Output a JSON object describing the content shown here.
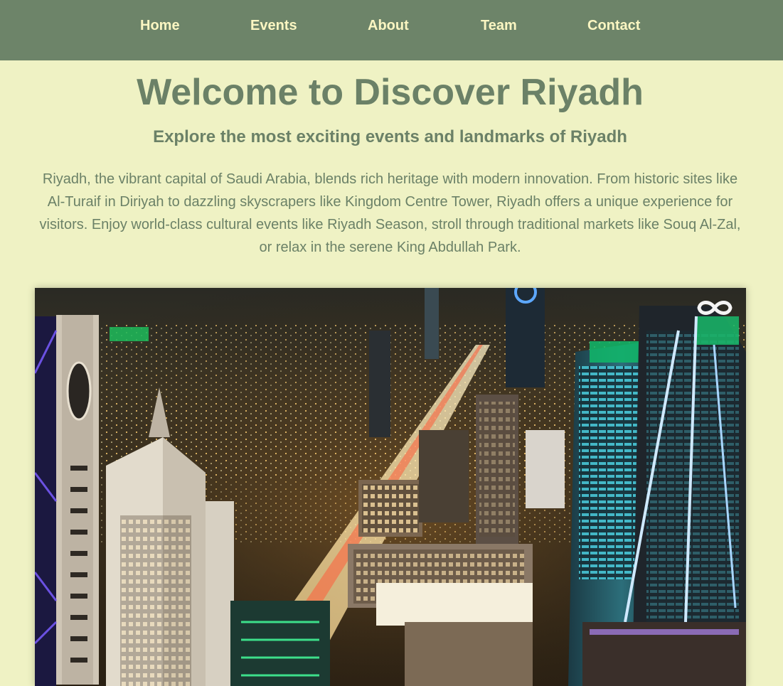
{
  "nav": {
    "items": [
      {
        "label": "Home"
      },
      {
        "label": "Events"
      },
      {
        "label": "About"
      },
      {
        "label": "Team"
      },
      {
        "label": "Contact"
      }
    ]
  },
  "hero": {
    "title": "Welcome to Discover Riyadh",
    "subtitle": "Explore the most exciting events and landmarks of Riyadh",
    "paragraph": "Riyadh, the vibrant capital of Saudi Arabia, blends rich heritage with modern innovation. From historic sites like Al-Turaif in Diriyah to dazzling skyscrapers like Kingdom Centre Tower, Riyadh offers a unique experience for visitors. Enjoy world-class cultural events like Riyadh Season, stroll through traditional markets like Souq Al-Zal, or relax in the serene King Abdullah Park."
  },
  "media": {
    "image_subject": "riyadh-night-skyline",
    "watermark_icon": "infinity-logo-icon"
  },
  "colors": {
    "nav_background": "#6d8469",
    "nav_text": "#fbf6c2",
    "page_background": "#eff2c4",
    "heading_text": "#6b8167"
  }
}
